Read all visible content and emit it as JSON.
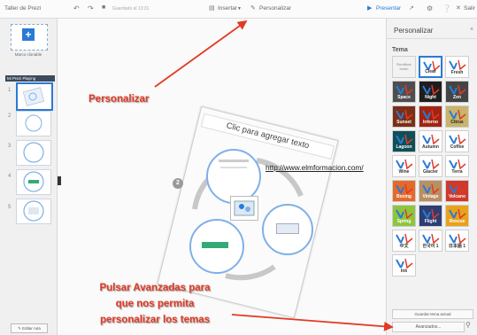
{
  "app_title": "Taller de Prezi",
  "save_status": "Guardado el 13:31",
  "toolbar": {
    "insert": "Insertar",
    "customize": "Personalizar",
    "present": "Presentar",
    "exit": "Salir"
  },
  "left_panel": {
    "add_frame_label": "Marco clonable",
    "path_header": "Mi Prezi Playing",
    "edit_path": "Editar ruta",
    "thumb_numbers": [
      "1",
      "2",
      "3",
      "4",
      "5"
    ]
  },
  "canvas": {
    "title_placeholder": "Clic para agregar texto",
    "url": "http://www.elmformacion.com/",
    "step_badge": "2"
  },
  "right_panel": {
    "title": "Personalizar",
    "section": "Tema",
    "themes": [
      {
        "name": "Reutilizar\nfondo",
        "bg": "#f2f2f2",
        "fg": "#888888"
      },
      {
        "name": "Clear",
        "bg": "#ffffff",
        "fg": "#333333"
      },
      {
        "name": "Fresh",
        "bg": "#ffffff",
        "fg": "#333333"
      },
      {
        "name": "Space",
        "bg": "#4e4e4e",
        "fg": "#ffffff"
      },
      {
        "name": "Night",
        "bg": "#1e1e1e",
        "fg": "#ffffff"
      },
      {
        "name": "Zen",
        "bg": "#444444",
        "fg": "#ffffff"
      },
      {
        "name": "Sunset",
        "bg": "#7b2f17",
        "fg": "#ffffff"
      },
      {
        "name": "Inferno",
        "bg": "#a12412",
        "fg": "#ffffff"
      },
      {
        "name": "Citrus",
        "bg": "#c9b46b",
        "fg": "#222222"
      },
      {
        "name": "Lagoon",
        "bg": "#0f4f57",
        "fg": "#ffffff"
      },
      {
        "name": "Autumn",
        "bg": "#ffffff",
        "fg": "#333333"
      },
      {
        "name": "Coffee",
        "bg": "#ffffff",
        "fg": "#333333"
      },
      {
        "name": "Wine",
        "bg": "#ffffff",
        "fg": "#333333"
      },
      {
        "name": "Glacier",
        "bg": "#ffffff",
        "fg": "#333333"
      },
      {
        "name": "Terra",
        "bg": "#ffffff",
        "fg": "#333333"
      },
      {
        "name": "Boxing",
        "bg": "#e46a2b",
        "fg": "#ffffff"
      },
      {
        "name": "Vintage",
        "bg": "#b98f62",
        "fg": "#ffffff"
      },
      {
        "name": "Volcano",
        "bg": "#d0382a",
        "fg": "#ffffff"
      },
      {
        "name": "Spring",
        "bg": "#8cc63f",
        "fg": "#ffffff"
      },
      {
        "name": "Flight",
        "bg": "#2d3e75",
        "fg": "#ffffff"
      },
      {
        "name": "Rescue",
        "bg": "#e8a21b",
        "fg": "#ffffff"
      },
      {
        "name": "中文",
        "bg": "#ffffff",
        "fg": "#333333"
      },
      {
        "name": "한국어 1",
        "bg": "#ffffff",
        "fg": "#333333"
      },
      {
        "name": "日本語 1",
        "bg": "#ffffff",
        "fg": "#333333"
      },
      {
        "name": "Ink",
        "bg": "#ffffff",
        "fg": "#333333"
      }
    ],
    "save_theme": "Guardar tema actual",
    "advanced": "Avanzados..."
  },
  "annotations": {
    "personalizar": "Personalizar",
    "pulsar_line1": "Pulsar Avanzadas para",
    "pulsar_line2": "que nos permita",
    "pulsar_line3": "personalizar los temas"
  },
  "colors": {
    "accent": "#2a7ad6",
    "annotation_red": "#e23a24",
    "circle_blue": "#7fb0e8"
  }
}
